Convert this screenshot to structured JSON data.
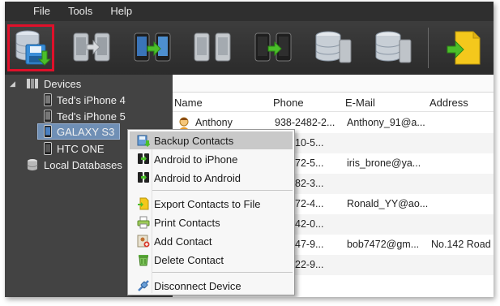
{
  "menu": [
    "File",
    "Tools",
    "Help"
  ],
  "toolbar": {
    "buttons": [
      {
        "name": "backup-database-button",
        "active": true
      },
      {
        "name": "iphone-to-iphone-button",
        "active": false
      },
      {
        "name": "android-to-iphone-button",
        "active": false
      },
      {
        "name": "iphone-to-android-button",
        "active": false
      },
      {
        "name": "android-to-android-button",
        "active": false
      },
      {
        "name": "database-to-phone-button",
        "active": false
      },
      {
        "name": "phone-to-database-button",
        "active": false
      },
      {
        "name": "export-file-button",
        "active": false
      }
    ]
  },
  "tree": {
    "devices_label": "Devices",
    "devices": [
      {
        "label": "Ted's iPhone 4",
        "type": "iphone"
      },
      {
        "label": "Ted's iPhone 5",
        "type": "iphone"
      },
      {
        "label": "GALAXY S3",
        "type": "android",
        "selected": true
      },
      {
        "label": "HTC ONE",
        "type": "android"
      }
    ],
    "local_label": "Local Databases"
  },
  "list": {
    "columns": {
      "name": "Name",
      "phone": "Phone",
      "email": "E-Mail",
      "address": "Address"
    },
    "rows": [
      {
        "name": "Anthony",
        "phone": "938-2482-2...",
        "email": "Anthony_91@a...",
        "address": ""
      },
      {
        "name": "",
        "phone": "3-4210-5...",
        "email": "",
        "address": ""
      },
      {
        "name": "",
        "phone": "2-4872-5...",
        "email": "iris_brone@ya...",
        "address": ""
      },
      {
        "name": "",
        "phone": "4-1982-3...",
        "email": "",
        "address": ""
      },
      {
        "name": "",
        "phone": "7-3872-4...",
        "email": "Ronald_YY@ao...",
        "address": ""
      },
      {
        "name": "",
        "phone": "3-1942-0...",
        "email": "",
        "address": ""
      },
      {
        "name": "",
        "phone": "3-2847-9...",
        "email": "bob7472@gm...",
        "address": "No.142 Road"
      },
      {
        "name": "",
        "phone": "2-4822-9...",
        "email": "",
        "address": ""
      }
    ]
  },
  "context_menu": {
    "backup": "Backup Contacts",
    "android_to_iphone": "Android to iPhone",
    "android_to_android": "Android to Android",
    "export": "Export Contacts to File",
    "print": "Print Contacts",
    "add": "Add Contact",
    "delete": "Delete Contact",
    "disconnect": "Disconnect Device"
  },
  "colors": {
    "active_outline": "#e0102a",
    "selection": "#6f8fb5",
    "arrow_green": "#4bbf2a"
  }
}
